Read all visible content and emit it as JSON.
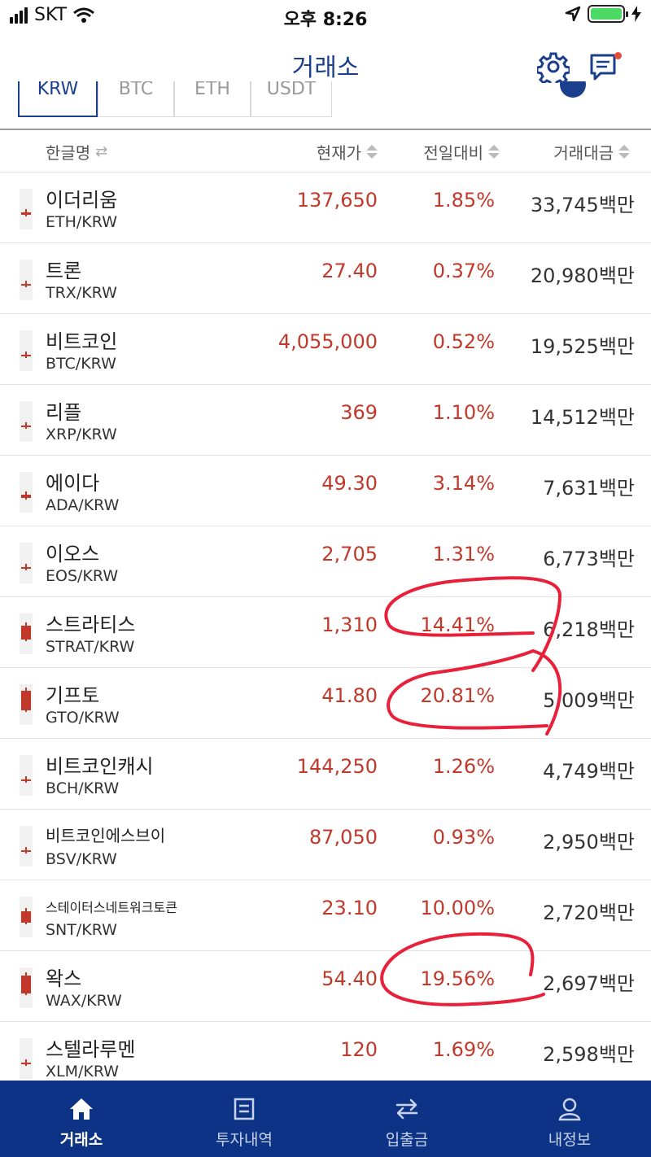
{
  "status_bar": {
    "carrier": "SKT",
    "time": "오후 8:26"
  },
  "header": {
    "title": "거래소",
    "settings_icon": "gear-icon",
    "messages_icon": "chat-icon"
  },
  "market_tabs": {
    "items": [
      "KRW",
      "BTC",
      "ETH",
      "USDT"
    ],
    "active": "KRW"
  },
  "columns": {
    "name": "한글명",
    "price": "현재가",
    "change": "전일대비",
    "volume": "거래대금"
  },
  "coins": [
    {
      "name": "이더리움",
      "symbol": "ETH/KRW",
      "price": "137,650",
      "change": "1.85%",
      "volume": "33,745",
      "volume_unit": "백만",
      "candle_level": 0.1
    },
    {
      "name": "트론",
      "symbol": "TRX/KRW",
      "price": "27.40",
      "change": "0.37%",
      "volume": "20,980",
      "volume_unit": "백만",
      "candle_level": 0.05
    },
    {
      "name": "비트코인",
      "symbol": "BTC/KRW",
      "price": "4,055,000",
      "change": "0.52%",
      "volume": "19,525",
      "volume_unit": "백만",
      "candle_level": 0.05
    },
    {
      "name": "리플",
      "symbol": "XRP/KRW",
      "price": "369",
      "change": "1.10%",
      "volume": "14,512",
      "volume_unit": "백만",
      "candle_level": 0.07
    },
    {
      "name": "에이다",
      "symbol": "ADA/KRW",
      "price": "49.30",
      "change": "3.14%",
      "volume": "7,631",
      "volume_unit": "백만",
      "candle_level": 0.15
    },
    {
      "name": "이오스",
      "symbol": "EOS/KRW",
      "price": "2,705",
      "change": "1.31%",
      "volume": "6,773",
      "volume_unit": "백만",
      "candle_level": 0.08
    },
    {
      "name": "스트라티스",
      "symbol": "STRAT/KRW",
      "price": "1,310",
      "change": "14.41%",
      "volume": "6,218",
      "volume_unit": "백만",
      "candle_level": 0.6
    },
    {
      "name": "기프토",
      "symbol": "GTO/KRW",
      "price": "41.80",
      "change": "20.81%",
      "volume": "5,009",
      "volume_unit": "백만",
      "candle_level": 0.85
    },
    {
      "name": "비트코인캐시",
      "symbol": "BCH/KRW",
      "price": "144,250",
      "change": "1.26%",
      "volume": "4,749",
      "volume_unit": "백만",
      "candle_level": 0.08
    },
    {
      "name": "비트코인에스브이",
      "symbol": "BSV/KRW",
      "price": "87,050",
      "change": "0.93%",
      "volume": "2,950",
      "volume_unit": "백만",
      "candle_level": 0.06
    },
    {
      "name": "스테이터스네트워크토큰",
      "symbol": "SNT/KRW",
      "price": "23.10",
      "change": "10.00%",
      "volume": "2,720",
      "volume_unit": "백만",
      "candle_level": 0.5
    },
    {
      "name": "왁스",
      "symbol": "WAX/KRW",
      "price": "54.40",
      "change": "19.56%",
      "volume": "2,697",
      "volume_unit": "백만",
      "candle_level": 0.8
    },
    {
      "name": "스텔라루멘",
      "symbol": "XLM/KRW",
      "price": "120",
      "change": "1.69%",
      "volume": "2,598",
      "volume_unit": "백만",
      "candle_level": 0.08
    }
  ],
  "bottom_nav": [
    {
      "label": "거래소",
      "icon": "home-icon",
      "active": true
    },
    {
      "label": "투자내역",
      "icon": "document-icon",
      "active": false
    },
    {
      "label": "입출금",
      "icon": "transfer-icon",
      "active": false
    },
    {
      "label": "내정보",
      "icon": "person-icon",
      "active": false
    }
  ],
  "colors": {
    "brand": "#1b3f8c",
    "nav_bg": "#0d3386",
    "rise": "#c0392b",
    "annotation": "#e8203a"
  }
}
